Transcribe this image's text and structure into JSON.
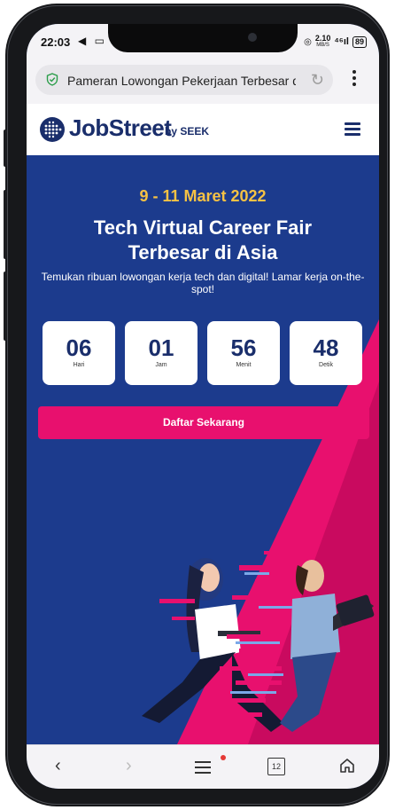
{
  "status": {
    "time": "22:03",
    "icons": "◀ ▭ ⊕",
    "net_speed_top": "2.10",
    "net_speed_unit": "MB/S",
    "signal": "⁴⁶ıl",
    "battery": "89"
  },
  "browser": {
    "url_text": "Pameran Lowongan Pekerjaan Terbesar di ...",
    "reload_glyph": "↻"
  },
  "header": {
    "logo_text": "JobStreet",
    "logo_by": "by SEEK"
  },
  "hero": {
    "date": "9 - 11 Maret 2022",
    "title_line1": "Tech Virtual Career Fair",
    "title_line2": "Terbesar di Asia",
    "subtitle": "Temukan ribuan lowongan kerja tech dan digital! Lamar kerja on-the-spot!",
    "countdown": [
      {
        "value": "06",
        "label": "Hari"
      },
      {
        "value": "01",
        "label": "Jam"
      },
      {
        "value": "56",
        "label": "Menit"
      },
      {
        "value": "48",
        "label": "Detik"
      }
    ],
    "cta_label": "Daftar Sekarang"
  },
  "nav": {
    "back": "‹",
    "forward": "›",
    "tabs_count": "12"
  },
  "colors": {
    "brand_navy": "#1a2e6b",
    "hero_blue": "#1c3b8d",
    "magenta": "#e8106e",
    "date_yellow": "#f6c244"
  }
}
